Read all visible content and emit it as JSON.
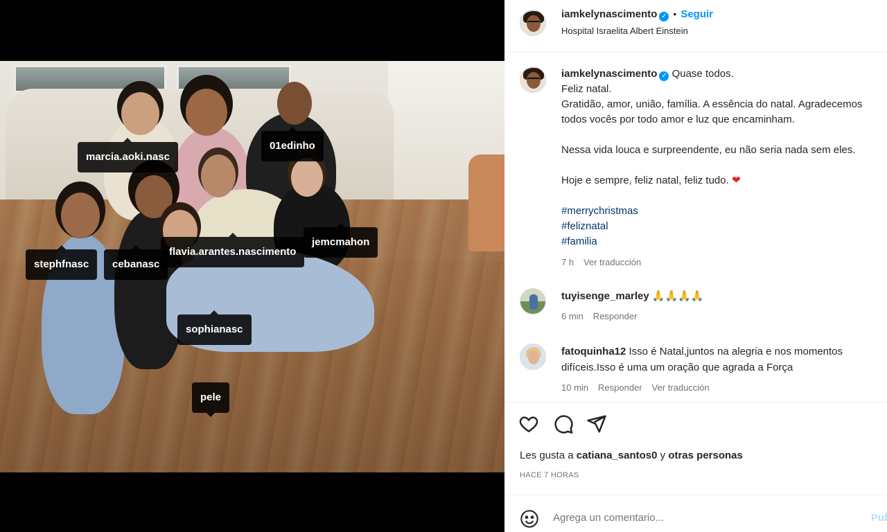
{
  "post": {
    "author": "iamkelynascimento",
    "follow_label": "Seguir",
    "dot": "•",
    "location": "Hospital Israelita Albert Einstein",
    "verified_mark": "✓",
    "caption_lead": "Quase todos.",
    "caption_lines": [
      "Feliz natal.",
      "Gratidão, amor, união, família. A essência do natal. Agradecemos",
      "todos vocês por todo amor e luz que encaminham."
    ],
    "caption_line_2": "Nessa vida louca e surpreendente, eu não seria nada sem eles.",
    "caption_line_3": "Hoje e sempre, feliz natal, feliz tudo.",
    "heart_emoji": "❤",
    "hashtags": [
      "#merrychristmas",
      "#feliznatal",
      "#familia"
    ],
    "time_ago": "7 h",
    "see_translation": "Ver traducción"
  },
  "photo_tags": [
    {
      "label": "marcia.aoki.nasc"
    },
    {
      "label": "01edinho"
    },
    {
      "label": "jemcmahon"
    },
    {
      "label": "stephfnasc"
    },
    {
      "label": "cebanasc"
    },
    {
      "label": "flavia.arantes.nascimento"
    },
    {
      "label": "sophianasc"
    },
    {
      "label": "pele"
    }
  ],
  "comments": [
    {
      "username": "tuyisenge_marley",
      "text": "🙏🙏🙏🙏",
      "time": "6 min",
      "reply": "Responder"
    },
    {
      "username": "fatoquinha12",
      "text_line_1": "Isso é Natal,juntos na alegria e nos momentos",
      "text_line_2": "difíceis.Isso é uma um oração que agrada a Força",
      "time": "10 min",
      "reply": "Responder",
      "translate": "Ver traducción"
    }
  ],
  "actions": {
    "icons": [
      "heart-icon",
      "comment-icon",
      "share-icon"
    ],
    "likes_prefix": "Les gusta a",
    "likes_user": "catiana_santos0",
    "likes_middle": "y",
    "likes_others": "otras personas",
    "posted_ago": "HACE 7 HORAS"
  },
  "composer": {
    "emoji_icon": "emoji-icon",
    "placeholder": "Agrega un comentario...",
    "publish_label": "Publicar"
  }
}
